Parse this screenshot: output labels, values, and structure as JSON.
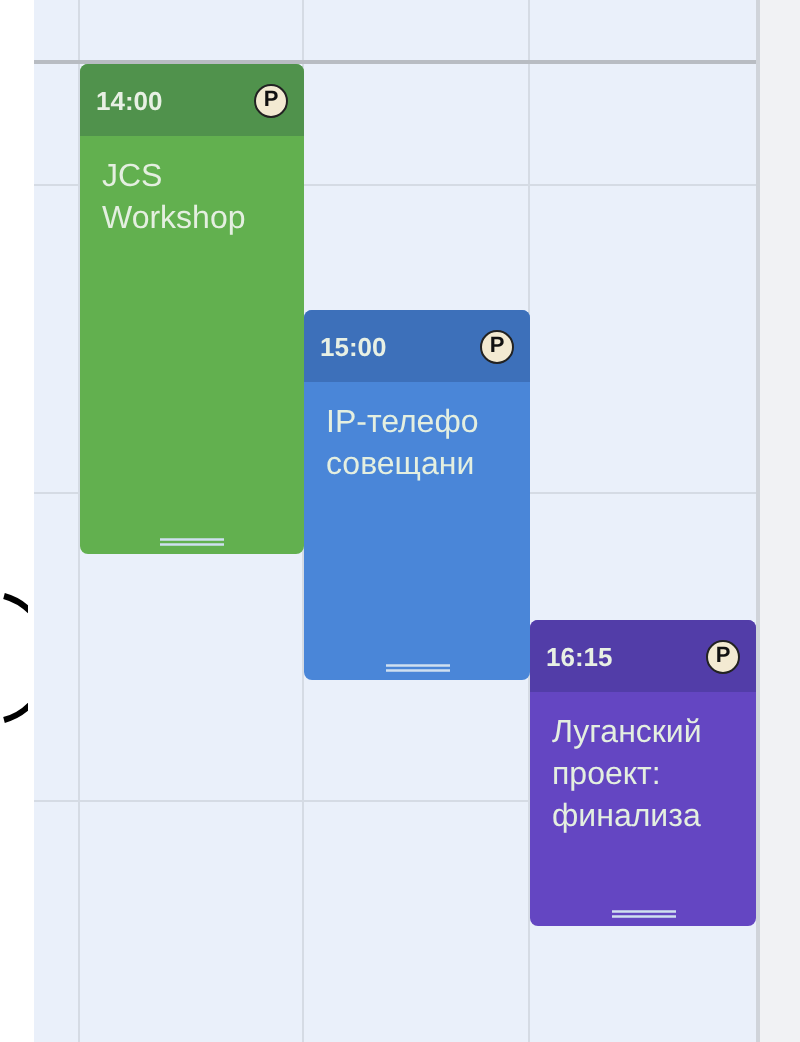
{
  "events": [
    {
      "time": "14:00",
      "badge": "P",
      "title": "JCS\nWorkshop",
      "color": "#62b04f"
    },
    {
      "time": "15:00",
      "badge": "P",
      "title": "IP-телефо\nсовещани",
      "color": "#4a86d8"
    },
    {
      "time": "16:15",
      "badge": "P",
      "title": "Луганский\nпроект:\nфинализа",
      "color": "#6446c2"
    }
  ]
}
